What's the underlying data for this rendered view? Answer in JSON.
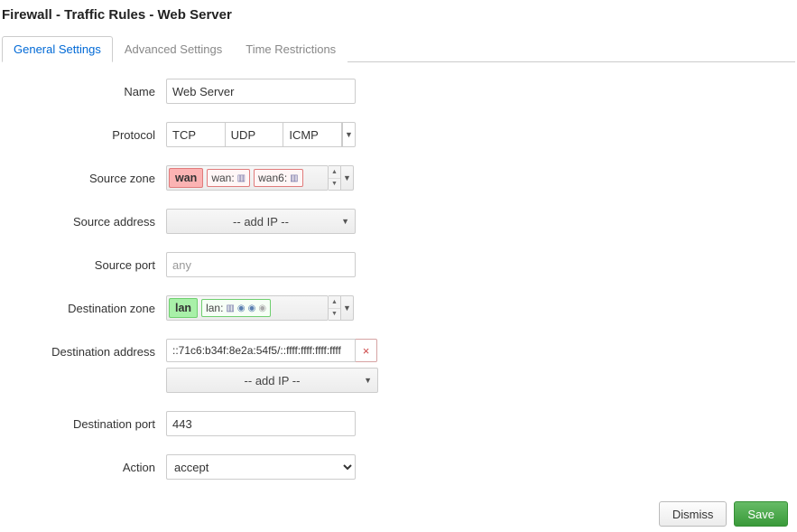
{
  "title": "Firewall - Traffic Rules - Web Server",
  "tabs": {
    "general": "General Settings",
    "advanced": "Advanced Settings",
    "time": "Time Restrictions"
  },
  "labels": {
    "name": "Name",
    "protocol": "Protocol",
    "source_zone": "Source zone",
    "source_address": "Source address",
    "source_port": "Source port",
    "destination_zone": "Destination zone",
    "destination_address": "Destination address",
    "destination_port": "Destination port",
    "action": "Action"
  },
  "values": {
    "name": "Web Server",
    "protocol": {
      "p1": "TCP",
      "p2": "UDP",
      "p3": "ICMP"
    },
    "source_zone": {
      "zone_name": "wan",
      "iface1": "wan:",
      "iface2": "wan6:"
    },
    "source_address_placeholder": "-- add IP --",
    "source_port_placeholder": "any",
    "destination_zone": {
      "zone_name": "lan",
      "iface1": "lan:"
    },
    "destination_address": "::71c6:b34f:8e2a:54f5/::ffff:ffff:ffff:ffff",
    "destination_address_add": "-- add IP --",
    "destination_port": "443",
    "action_selected": "accept"
  },
  "buttons": {
    "dismiss": "Dismiss",
    "save": "Save"
  }
}
